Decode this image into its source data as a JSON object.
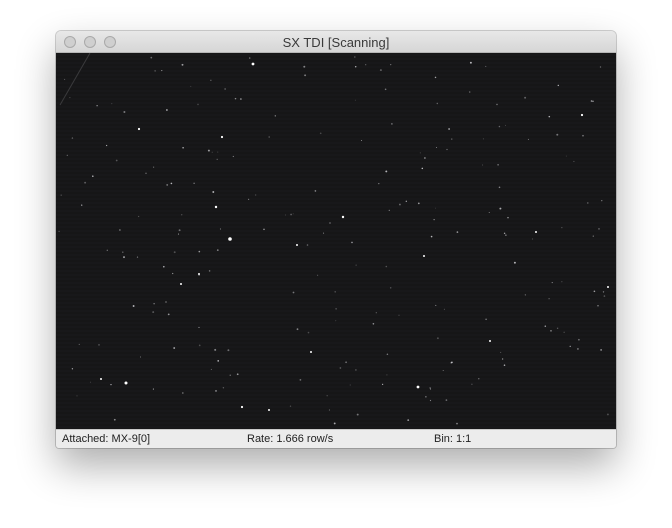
{
  "window": {
    "title": "SX TDI [Scanning]"
  },
  "status": {
    "attached": "Attached: MX-9[0]",
    "rate": "Rate: 1.666 row/s",
    "bin": "Bin: 1:1"
  },
  "colors": {
    "image_background": "#161617",
    "star": "#ffffff",
    "window_chrome": "#ececec"
  }
}
